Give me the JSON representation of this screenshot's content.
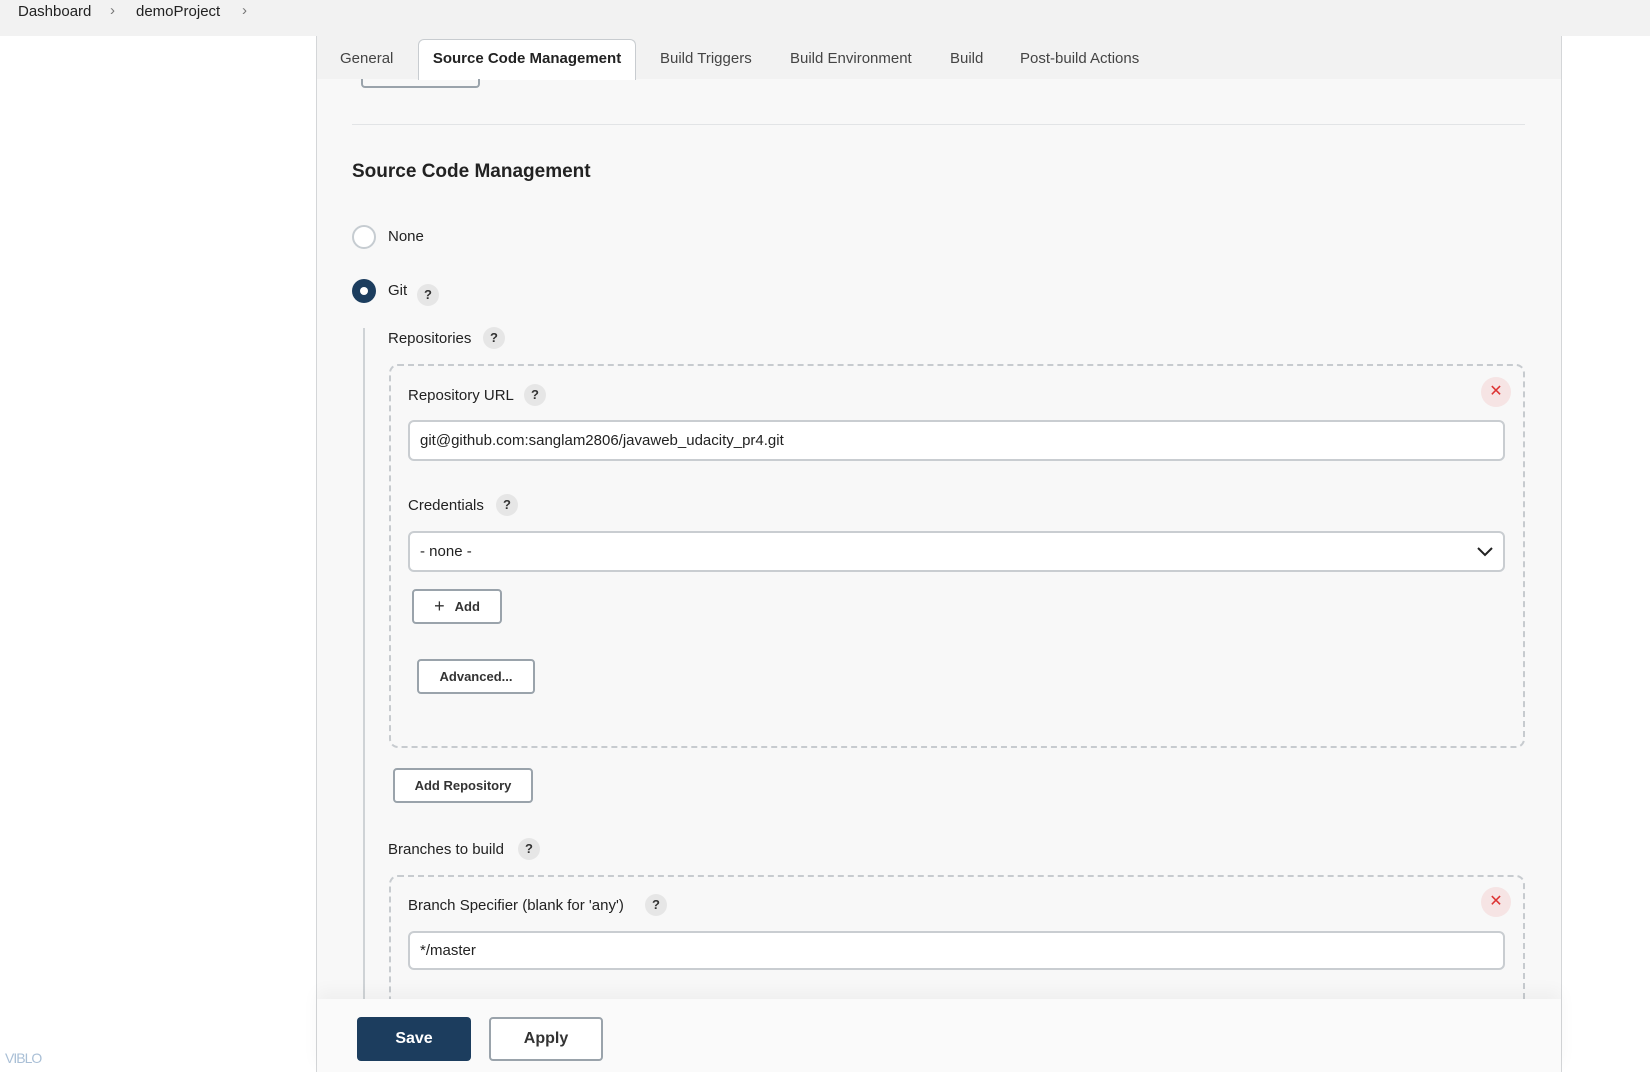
{
  "breadcrumb": [
    "Dashboard",
    "demoProject"
  ],
  "tabs": [
    "General",
    "Source Code Management",
    "Build Triggers",
    "Build Environment",
    "Build",
    "Post-build Actions"
  ],
  "section_title": "Source Code Management",
  "scm_options": {
    "none": "None",
    "git": "Git",
    "selected": "Git"
  },
  "repositories": {
    "label": "Repositories",
    "url_label": "Repository URL",
    "url_value": "git@github.com:sanglam2806/javaweb_udacity_pr4.git",
    "credentials_label": "Credentials",
    "credentials_value": "- none -",
    "add_label": "Add",
    "advanced_label": "Advanced...",
    "add_repository_label": "Add Repository"
  },
  "branches": {
    "label": "Branches to build",
    "specifier_label": "Branch Specifier (blank for 'any')",
    "specifier_value": "*/master"
  },
  "help": "?",
  "footer": {
    "save": "Save",
    "apply": "Apply"
  },
  "watermark": "VIBLO",
  "colors": {
    "primary": "#1c3d5e",
    "danger": "#d33"
  }
}
